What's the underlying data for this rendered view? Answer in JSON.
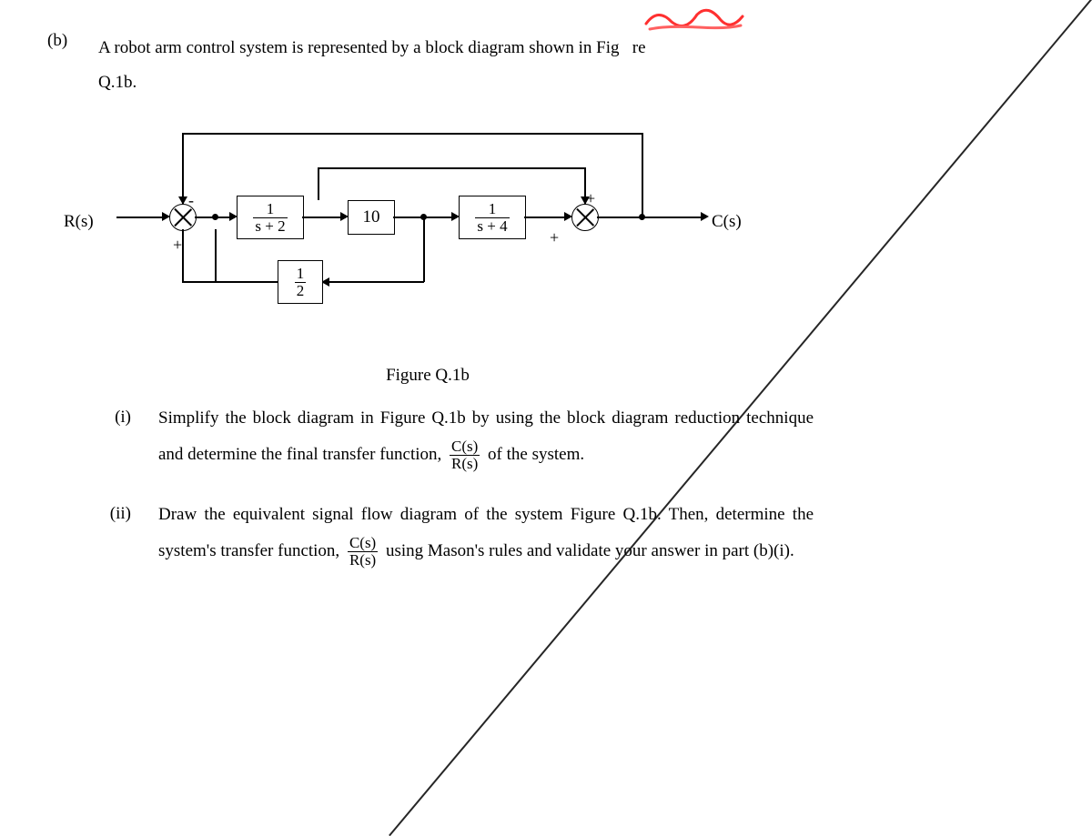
{
  "problem": {
    "label": "(b)",
    "intro_1": "A robot arm control system is represented by a block diagram shown in Fig",
    "intro_2": "re",
    "intro_3": "Q.1b."
  },
  "diagram": {
    "input": "R(s)",
    "output": "C(s)",
    "block1_num": "1",
    "block1_den": "s + 2",
    "block2": "10",
    "block3_num": "1",
    "block3_den": "s + 4",
    "block4_num": "1",
    "block4_den": "2",
    "sign_minus": "-",
    "sign_plus1": "+",
    "sign_plus2": "+",
    "sign_plus3": "+",
    "caption": "Figure Q.1b"
  },
  "parts": {
    "i_label": "(i)",
    "i_text_1": "Simplify the block diagram in Figure Q.1b by using the block diagram reduction technique and determine the final transfer function, ",
    "i_text_2": " of the system.",
    "ii_label": "(ii)",
    "ii_text_1": "Draw the equivalent signal flow diagram of the system Figure Q.1b. Then, determine the system's transfer function, ",
    "ii_text_2": " using Mason's rules and validate your answer in part (b)(i).",
    "tf_num": "C(s)",
    "tf_den": "R(s)"
  }
}
